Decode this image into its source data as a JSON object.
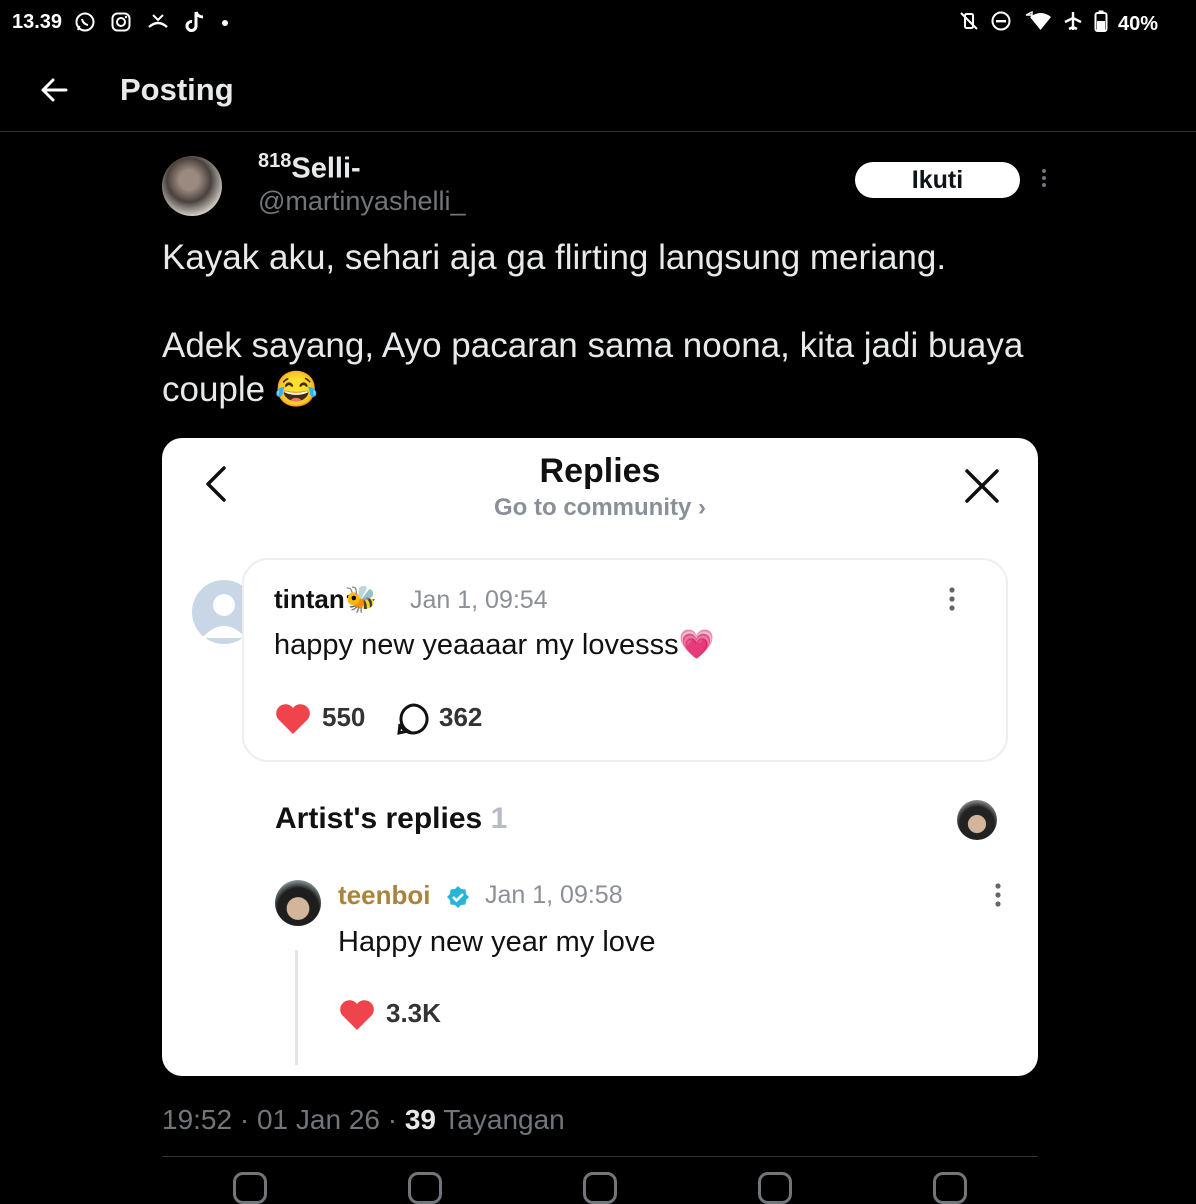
{
  "status_bar": {
    "time": "13.39",
    "left_icons": [
      "whatsapp-icon",
      "instagram-icon",
      "missed-call-icon",
      "tiktok-icon",
      "dot-icon"
    ],
    "right_icons": [
      "mute-vibrate-icon",
      "do-not-disturb-icon",
      "wifi-icon",
      "airplane-icon",
      "battery-icon"
    ],
    "battery": "40%"
  },
  "header": {
    "title": "Posting"
  },
  "post": {
    "author_prefix": "818",
    "author_name": "Selli-",
    "author_handle": "@martinyashelli_",
    "follow_label": "Ikuti",
    "text_line1": "Kayak aku, sehari aja ga flirting langsung meriang.",
    "text_line2": "Adek sayang, Ayo pacaran sama noona, kita jadi buaya couple 😂"
  },
  "embed": {
    "title": "Replies",
    "subtitle": "Go to community ›",
    "reply": {
      "user": "tintan🐝",
      "time": "Jan 1, 09:54",
      "text": "happy new yeaaaar my lovesss💗",
      "likes": "550",
      "replies": "362"
    },
    "artist_section": {
      "label": "Artist's replies",
      "count": "1"
    },
    "artist_reply": {
      "user": "teenboi",
      "time": "Jan 1, 09:58",
      "text": "Happy new year my love",
      "likes": "3.3K"
    }
  },
  "meta": {
    "time": "19:52",
    "date": "01 Jan 26",
    "views": "39",
    "views_label": "Tayangan"
  },
  "colors": {
    "background": "#000000",
    "follow_bg": "#ffffff",
    "heart": "#f0444c",
    "verified": "#27b4d8",
    "artist_name": "#a8843d"
  }
}
